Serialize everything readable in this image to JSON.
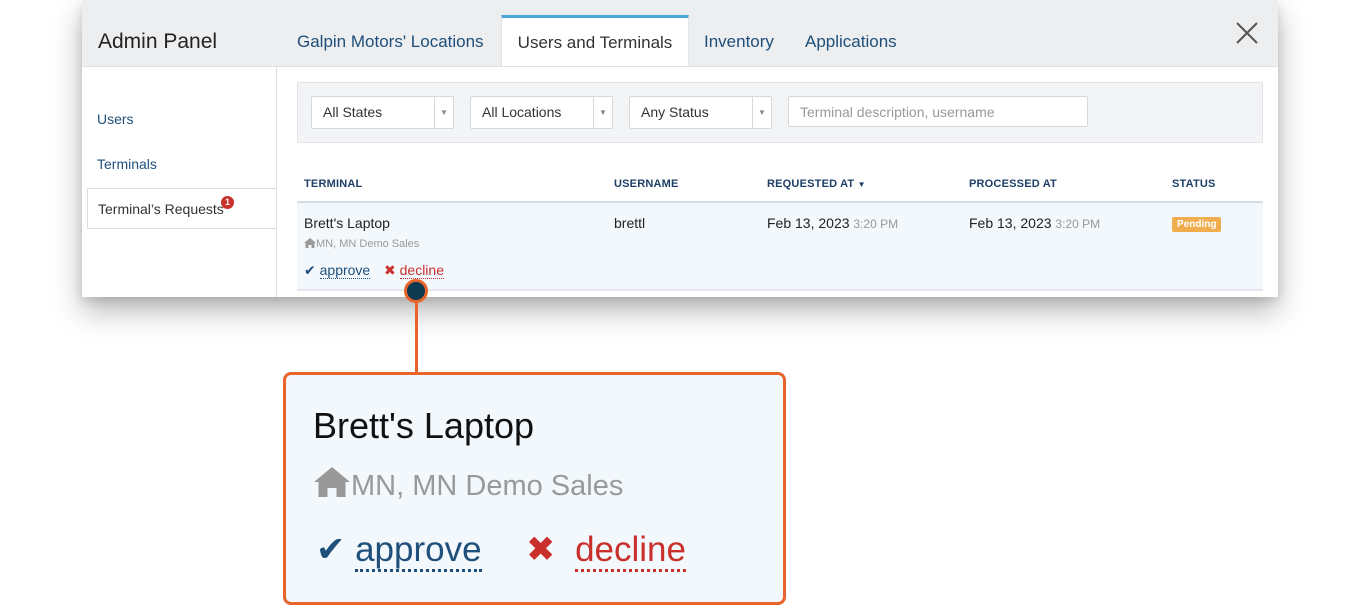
{
  "header": {
    "title": "Admin Panel",
    "tabs": [
      {
        "label": "Galpin Motors' Locations",
        "active": false
      },
      {
        "label": "Users and Terminals",
        "active": true
      },
      {
        "label": "Inventory",
        "active": false
      },
      {
        "label": "Applications",
        "active": false
      }
    ],
    "close_icon": "close-icon"
  },
  "sidebar": {
    "items": [
      {
        "label": "Users",
        "active": false
      },
      {
        "label": "Terminals",
        "active": false
      },
      {
        "label": "Terminal’s Requests",
        "active": true,
        "badge": "1"
      }
    ]
  },
  "filters": {
    "state": {
      "selected": "All States"
    },
    "location": {
      "selected": "All Locations"
    },
    "status": {
      "selected": "Any Status"
    },
    "search": {
      "value": "",
      "placeholder": "Terminal description, username"
    }
  },
  "table": {
    "columns": [
      {
        "label": "TERMINAL"
      },
      {
        "label": "USERNAME"
      },
      {
        "label": "REQUESTED AT",
        "sort": "desc"
      },
      {
        "label": "PROCESSED AT"
      },
      {
        "label": "STATUS"
      }
    ],
    "rows": [
      {
        "terminal": "Brett's Laptop",
        "location": "MN, MN Demo Sales",
        "username": "brettl",
        "requested_date": "Feb 13, 2023",
        "requested_time": "3:20 PM",
        "processed_date": "Feb 13, 2023",
        "processed_time": "3:20 PM",
        "status": "Pending",
        "actions": {
          "approve": "approve",
          "decline": "decline"
        }
      }
    ]
  },
  "callout": {
    "terminal": "Brett's Laptop",
    "location": "MN, MN Demo Sales",
    "approve": "approve",
    "decline": "decline"
  },
  "colors": {
    "accent": "#4aa8d8",
    "link": "#1f4f7a",
    "decline": "#c9302c",
    "pending": "#f0ad4e",
    "callout_border": "#e8642a"
  }
}
